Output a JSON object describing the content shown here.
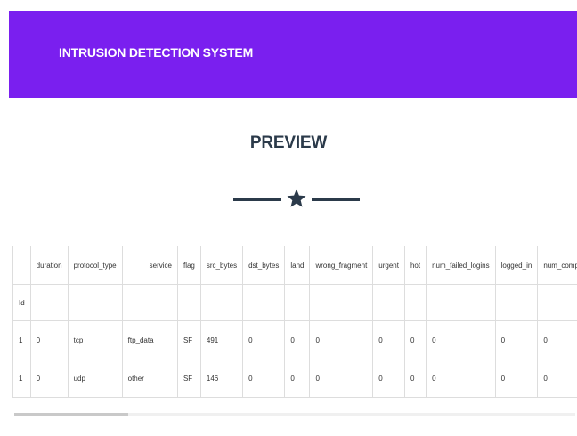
{
  "header": {
    "brand": "INTRUSION DETECTION SYSTEM",
    "color": "#7a1fef"
  },
  "section": {
    "title": "PREVIEW",
    "divider_icon": "star-icon"
  },
  "table": {
    "columns": [
      "",
      "duration",
      "protocol_type",
      "service",
      "flag",
      "src_bytes",
      "dst_bytes",
      "land",
      "wrong_fragment",
      "urgent",
      "hot",
      "num_failed_logins",
      "logged_in",
      "num_comprom"
    ],
    "index_label": "Id",
    "rows": [
      [
        "1",
        "0",
        "tcp",
        "ftp_data",
        "SF",
        "491",
        "0",
        "0",
        "0",
        "0",
        "0",
        "0",
        "0",
        "0"
      ],
      [
        "1",
        "0",
        "udp",
        "other",
        "SF",
        "146",
        "0",
        "0",
        "0",
        "0",
        "0",
        "0",
        "0",
        "0"
      ]
    ]
  }
}
